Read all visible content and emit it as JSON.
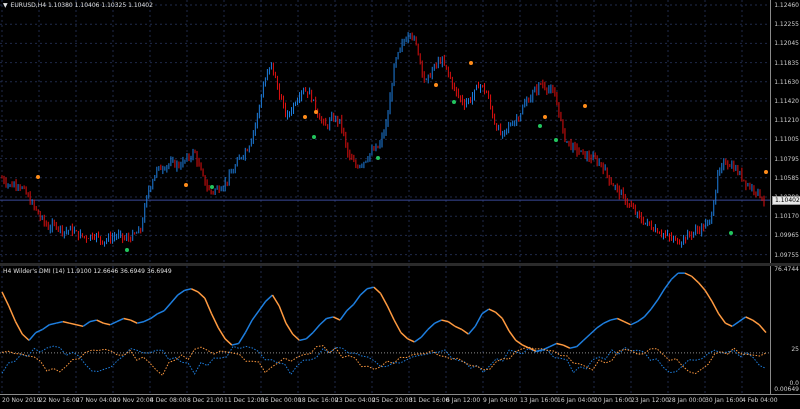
{
  "chart": {
    "symbol_caption": "EURUSD,H4  1.10380 1.10406 1.10325 1.10402",
    "current_price": "1.10402",
    "price_ticks": [
      "1.12460",
      "1.12255",
      "1.12045",
      "1.11835",
      "1.11630",
      "1.11420",
      "1.11210",
      "1.11005",
      "1.10795",
      "1.10585",
      "1.10380",
      "1.10170",
      "1.09965",
      "1.09755"
    ],
    "bull_color": "#1e7fe0",
    "bear_color": "#e01010",
    "dot_color_orange": "#ff8c1a",
    "dot_color_green": "#22c55e"
  },
  "indicator": {
    "caption": "H4 Wilder's DMI (14) 11.9100 12.6646 36.6949 36.6949",
    "axis_top": "76.4744",
    "axis_mid": "25",
    "axis_bottom": "0.0",
    "axis_bottom2": "0.00649",
    "adx_up_color": "#1e7fe0",
    "adx_down_color": "#ff9a40"
  },
  "time_axis": [
    "20 Nov 2019",
    "22 Nov 16:00",
    "27 Nov 04:00",
    "29 Nov 20:00",
    "4 Dec 08:00",
    "8 Dec 21:00",
    "11 Dec 12:00",
    "16 Dec 00:00",
    "18 Dec 16:00",
    "23 Dec 04:00",
    "25 Dec 20:00",
    "31 Dec 16:00",
    "6 Jan 12:00",
    "9 Jan 04:00",
    "13 Jan 16:00",
    "16 Jan 04:00",
    "20 Jan 16:00",
    "23 Jan 12:00",
    "28 Jan 00:00",
    "30 Jan 16:00",
    "4 Feb 04:00"
  ],
  "chart_data": {
    "type": "candlestick",
    "title": "EURUSD,H4",
    "ylim": [
      1.09755,
      1.1246
    ],
    "close_path": [
      1.1063,
      1.1055,
      1.1058,
      1.1048,
      1.1035,
      1.1022,
      1.1012,
      1.1015,
      1.1008,
      1.101,
      1.1004,
      1.1002,
      1.1005,
      1.0998,
      1.1001,
      1.1004,
      1.1,
      1.1003,
      1.1009,
      1.105,
      1.107,
      1.1075,
      1.1078,
      1.1076,
      1.1082,
      1.109,
      1.1065,
      1.1048,
      1.1052,
      1.1058,
      1.107,
      1.1085,
      1.1095,
      1.112,
      1.116,
      1.118,
      1.115,
      1.1125,
      1.114,
      1.1155,
      1.115,
      1.113,
      1.1115,
      1.1125,
      1.112,
      1.1085,
      1.1075,
      1.108,
      1.109,
      1.1095,
      1.112,
      1.118,
      1.12,
      1.1215,
      1.1195,
      1.116,
      1.1175,
      1.1185,
      1.117,
      1.115,
      1.114,
      1.1145,
      1.116,
      1.115,
      1.112,
      1.1105,
      1.1118,
      1.1125,
      1.114,
      1.115,
      1.116,
      1.1155,
      1.1145,
      1.1105,
      1.1095,
      1.109,
      1.1085,
      1.1082,
      1.1076,
      1.106,
      1.105,
      1.104,
      1.103,
      1.102,
      1.1015,
      1.101,
      1.1005,
      1.1,
      1.0998,
      1.1003,
      1.1008,
      1.1012,
      1.1018,
      1.1065,
      1.108,
      1.1075,
      1.1065,
      1.1055,
      1.105,
      1.104
    ],
    "adx": [
      64,
      55,
      45,
      37,
      33,
      38,
      40,
      43,
      44,
      45,
      44,
      43,
      42,
      45,
      46,
      44,
      43,
      45,
      47,
      46,
      44,
      45,
      47,
      50,
      52,
      57,
      62,
      65,
      66,
      64,
      60,
      50,
      41,
      34,
      30,
      31,
      38,
      46,
      52,
      58,
      62,
      55,
      44,
      37,
      33,
      34,
      38,
      43,
      47,
      48,
      46,
      52,
      56,
      62,
      66,
      67,
      63,
      55,
      46,
      38,
      34,
      32,
      35,
      40,
      44,
      46,
      45,
      42,
      40,
      37,
      42,
      50,
      53,
      51,
      47,
      39,
      33,
      30,
      28,
      26,
      27,
      29,
      31,
      30,
      28,
      29,
      33,
      37,
      41,
      44,
      46,
      47,
      45,
      43,
      45,
      48,
      53,
      59,
      66,
      72,
      76,
      76,
      74,
      70,
      65,
      58,
      50,
      44,
      42,
      45,
      48,
      46,
      43,
      38
    ]
  }
}
